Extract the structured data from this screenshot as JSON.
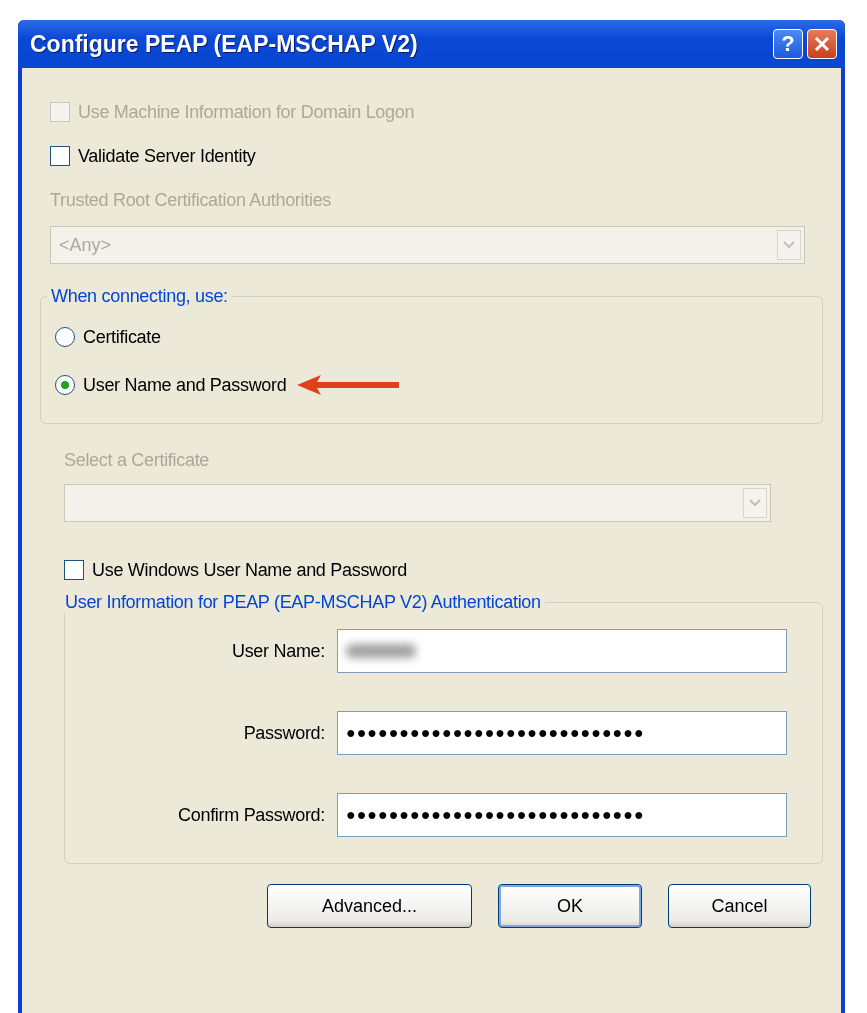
{
  "window": {
    "title": "Configure PEAP (EAP-MSCHAP V2)",
    "help": "?"
  },
  "options": [
    {
      "label": "Use Machine Information for Domain Logon",
      "checked": false,
      "disabled": true
    },
    {
      "label": "Validate Server Identity",
      "checked": false,
      "disabled": false
    }
  ],
  "trusted_root": {
    "label": "Trusted Root Certification Authorities",
    "value": "<Any>",
    "disabled": true
  },
  "connect_group": {
    "title": "When connecting, use:",
    "choices": [
      {
        "label": "Certificate",
        "selected": false
      },
      {
        "label": "User Name and Password",
        "selected": true
      }
    ]
  },
  "certificate": {
    "label": "Select a Certificate",
    "disabled": true
  },
  "windows_login": {
    "label": "Use Windows User Name and Password",
    "checked": false,
    "disabled": false
  },
  "user_info": {
    "title": "User Information for PEAP (EAP-MSCHAP V2) Authentication",
    "fields": [
      {
        "label": "User Name:",
        "kind": "blurred"
      },
      {
        "label": "Password:",
        "kind": "text",
        "value": "●●●●●●●●●●●●●●●●●●●●●●●●●●●●"
      },
      {
        "label": "Confirm Password:",
        "kind": "text",
        "value": "●●●●●●●●●●●●●●●●●●●●●●●●●●●●"
      }
    ]
  },
  "buttons": [
    {
      "label": "Advanced...",
      "default": false
    },
    {
      "label": "OK",
      "default": true
    },
    {
      "label": "Cancel",
      "default": false
    }
  ]
}
